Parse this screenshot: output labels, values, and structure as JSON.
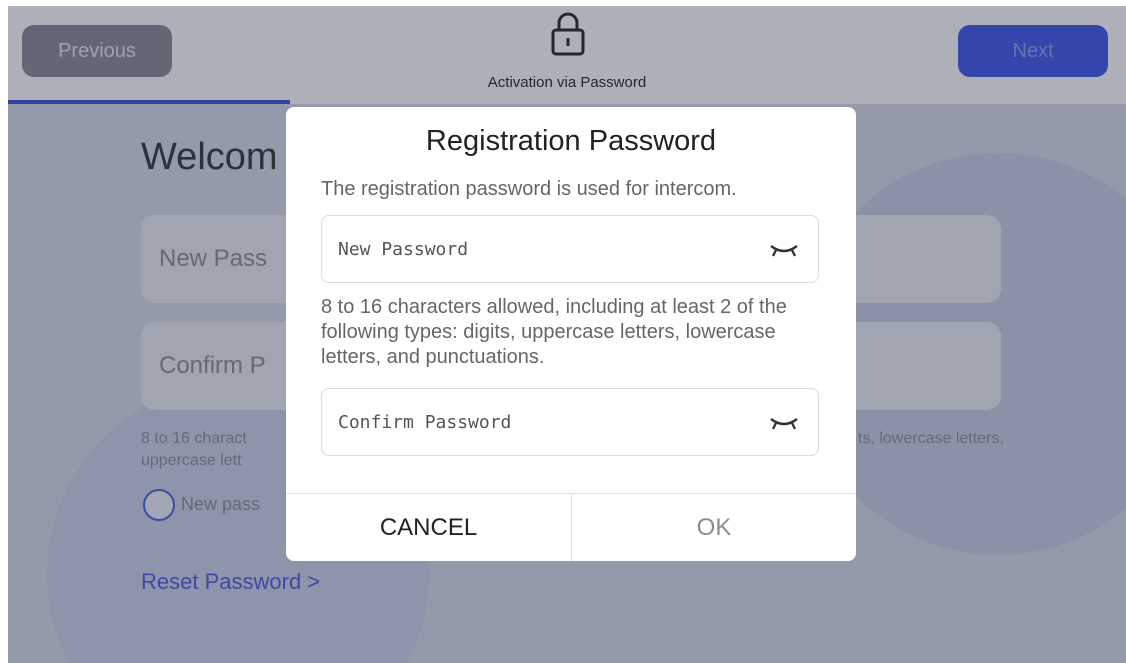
{
  "header": {
    "previous_label": "Previous",
    "next_label": "Next",
    "title": "Activation via Password",
    "lock_icon": "lock-icon"
  },
  "background": {
    "welcome": "Welcom",
    "new_password_placeholder": "New Pass",
    "confirm_password_placeholder": "Confirm P",
    "hint_line1": "8 to 16 charact",
    "hint_line1_right": "ts, lowercase letters,",
    "hint_line2": "uppercase lett",
    "checkbox_label": "New pass",
    "reset_link": "Reset Password >"
  },
  "dialog": {
    "title": "Registration Password",
    "description": "The registration password is used for intercom.",
    "new_password_placeholder": "New Password",
    "rules": "8 to 16 characters allowed, including at least 2 of the following types: digits, uppercase letters, lowercase letters, and punctuations.",
    "confirm_password_placeholder": "Confirm Password",
    "cancel_label": "CANCEL",
    "ok_label": "OK",
    "eye_icon": "eye-closed-icon"
  },
  "colors": {
    "accent": "#3d55e8",
    "link": "#4a5ce0",
    "previous_button": "#8a8a92"
  }
}
